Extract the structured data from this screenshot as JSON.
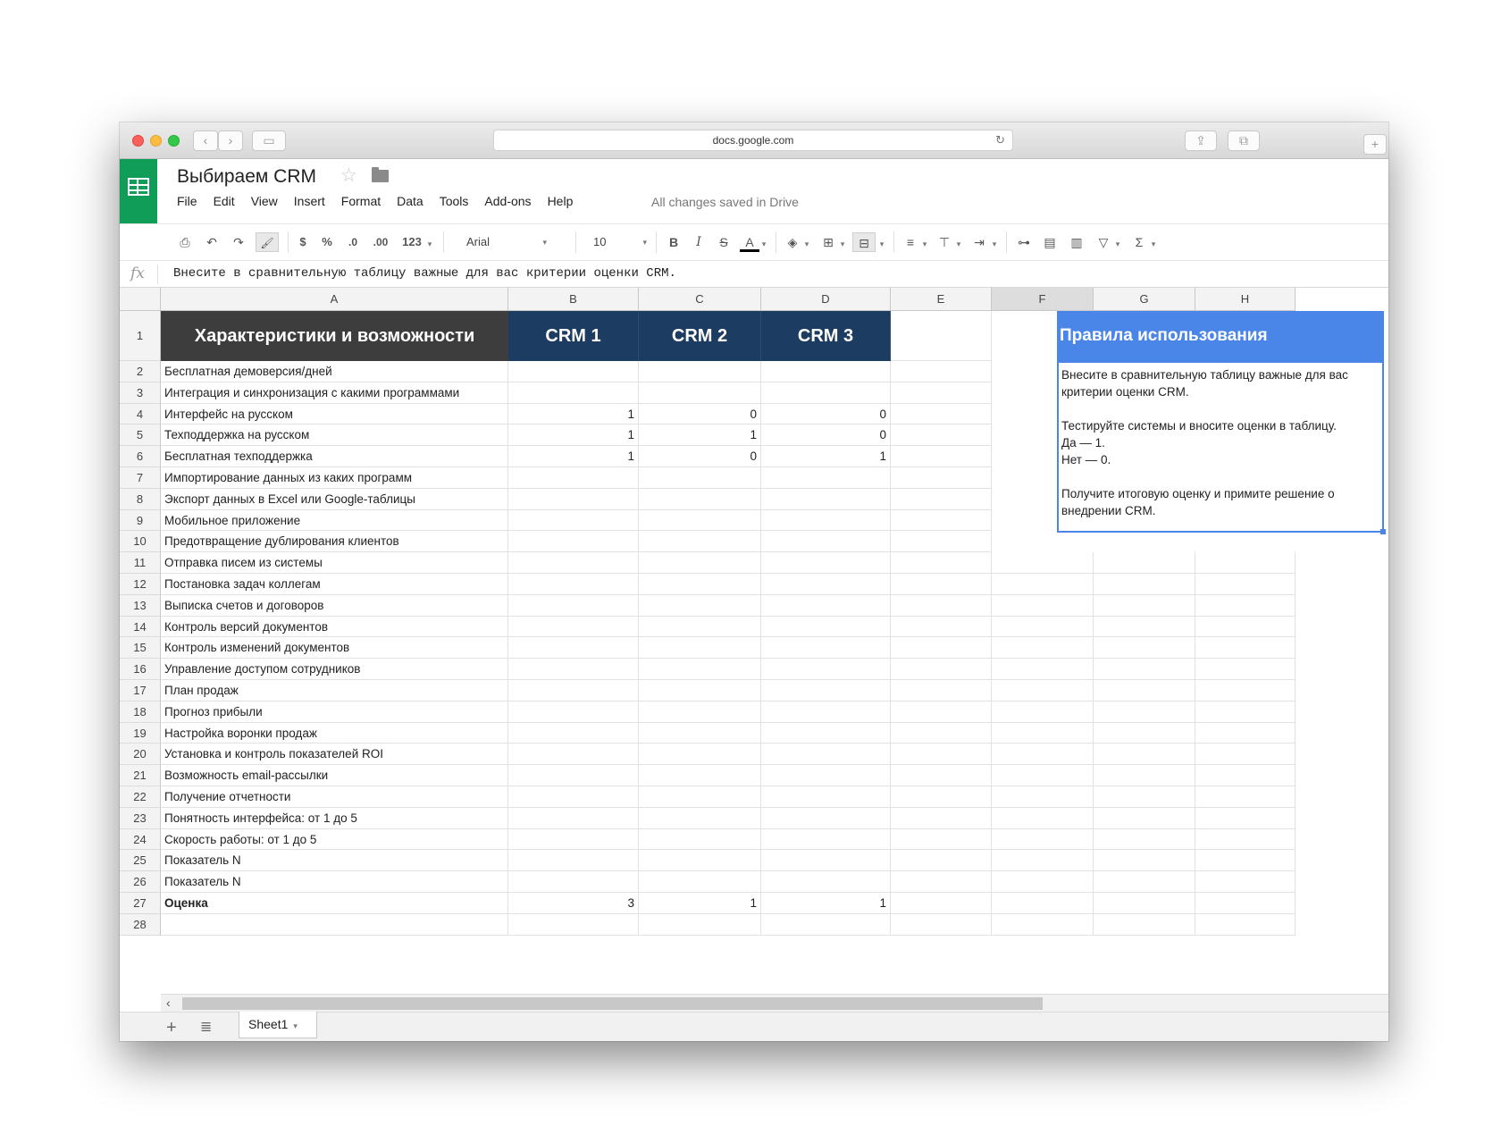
{
  "browser": {
    "url": "docs.google.com",
    "back_icon": "‹",
    "forward_icon": "›",
    "sidebar_icon": "▭",
    "reload_icon": "↻",
    "share_icon": "⇪",
    "tabs_icon": "⧉",
    "newtab_icon": "+"
  },
  "doc": {
    "title": "Выбираем CRM",
    "star_icon": "☆",
    "saved_status": "All changes saved in Drive",
    "menu": [
      "File",
      "Edit",
      "View",
      "Insert",
      "Format",
      "Data",
      "Tools",
      "Add-ons",
      "Help"
    ]
  },
  "toolbar": {
    "print_icon": "⎙",
    "undo_icon": "↶",
    "redo_icon": "↷",
    "paint_icon": "🖌",
    "currency": "$",
    "percent": "%",
    "dec_less": ".0",
    "dec_more": ".00",
    "more_formats": "123",
    "font": "Arial",
    "font_size": "10",
    "bold": "B",
    "italic": "I",
    "strike": "S",
    "text_color": "A",
    "fill_icon": "◈",
    "borders_icon": "⊞",
    "merge_icon": "⊟",
    "halign_icon": "≡",
    "valign_icon": "⊤",
    "wrap_icon": "⇥",
    "link_icon": "⊶",
    "comment_icon": "▤",
    "chart_icon": "▥",
    "filter_icon": "▽",
    "functions_icon": "Σ",
    "dropdown": "▾"
  },
  "formula_bar": {
    "fx": "fx",
    "content": "Внесите в сравнительную таблицу важные для вас критерии оценки CRM."
  },
  "columns": [
    "A",
    "B",
    "C",
    "D",
    "E",
    "F",
    "G",
    "H"
  ],
  "header_row": {
    "a": "Характеристики и возможности",
    "b": "CRM 1",
    "c": "CRM 2",
    "d": "CRM 3",
    "f": "Правила использования"
  },
  "rows": [
    {
      "n": "2",
      "a": "Бесплатная демоверсия/дней",
      "b": "",
      "c": "",
      "d": ""
    },
    {
      "n": "3",
      "a": "Интеграция и синхронизация с какими программами",
      "b": "",
      "c": "",
      "d": ""
    },
    {
      "n": "4",
      "a": "Интерфейс на русском",
      "b": "1",
      "c": "0",
      "d": "0"
    },
    {
      "n": "5",
      "a": "Техподдержка на русском",
      "b": "1",
      "c": "1",
      "d": "0"
    },
    {
      "n": "6",
      "a": "Бесплатная техподдержка",
      "b": "1",
      "c": "0",
      "d": "1"
    },
    {
      "n": "7",
      "a": "Импортирование данных из каких программ",
      "b": "",
      "c": "",
      "d": ""
    },
    {
      "n": "8",
      "a": "Экспорт данных в Excel или Google-таблицы",
      "b": "",
      "c": "",
      "d": ""
    },
    {
      "n": "9",
      "a": "Мобильное приложение",
      "b": "",
      "c": "",
      "d": ""
    },
    {
      "n": "10",
      "a": "Предотвращение дублирования клиентов",
      "b": "",
      "c": "",
      "d": ""
    },
    {
      "n": "11",
      "a": "Отправка писем из системы",
      "b": "",
      "c": "",
      "d": ""
    },
    {
      "n": "12",
      "a": "Постановка задач коллегам",
      "b": "",
      "c": "",
      "d": ""
    },
    {
      "n": "13",
      "a": "Выписка счетов и договоров",
      "b": "",
      "c": "",
      "d": ""
    },
    {
      "n": "14",
      "a": "Контроль версий документов",
      "b": "",
      "c": "",
      "d": ""
    },
    {
      "n": "15",
      "a": "Контроль изменений документов",
      "b": "",
      "c": "",
      "d": ""
    },
    {
      "n": "16",
      "a": "Управление доступом сотрудников",
      "b": "",
      "c": "",
      "d": ""
    },
    {
      "n": "17",
      "a": "План продаж",
      "b": "",
      "c": "",
      "d": ""
    },
    {
      "n": "18",
      "a": "Прогноз прибыли",
      "b": "",
      "c": "",
      "d": ""
    },
    {
      "n": "19",
      "a": "Настройка воронки продаж",
      "b": "",
      "c": "",
      "d": ""
    },
    {
      "n": "20",
      "a": "Установка и контроль показателей ROI",
      "b": "",
      "c": "",
      "d": ""
    },
    {
      "n": "21",
      "a": "Возможность email-рассылки",
      "b": "",
      "c": "",
      "d": ""
    },
    {
      "n": "22",
      "a": "Получение отчетности",
      "b": "",
      "c": "",
      "d": ""
    },
    {
      "n": "23",
      "a": "Понятность интерфейса: от 1 до 5",
      "b": "",
      "c": "",
      "d": ""
    },
    {
      "n": "24",
      "a": "Скорость работы: от 1 до 5",
      "b": "",
      "c": "",
      "d": ""
    },
    {
      "n": "25",
      "a": "Показатель N",
      "b": "",
      "c": "",
      "d": ""
    },
    {
      "n": "26",
      "a": "Показатель N",
      "b": "",
      "c": "",
      "d": ""
    },
    {
      "n": "27",
      "a": "Оценка",
      "b": "3",
      "c": "1",
      "d": "1",
      "bold": true
    },
    {
      "n": "28",
      "a": "",
      "b": "",
      "c": "",
      "d": ""
    }
  ],
  "rules": {
    "line1": "Внесите в сравнительную таблицу важные для вас критерии оценки CRM.",
    "line2": "Тестируйте системы и вносите оценки в таблицу.",
    "line3": "Да — 1.",
    "line4": "Нет — 0.",
    "line5": "Получите итоговую оценку и примите решение о внедрении CRM."
  },
  "sheets": {
    "add_icon": "+",
    "list_icon": "≣",
    "scroll_left_icon": "‹",
    "tab": "Sheet1",
    "tab_caret": "▾"
  },
  "colors": {
    "sheets_green": "#0f9d58",
    "header_dark": "#3d3d3d",
    "header_navy": "#1c3d61",
    "header_blue": "#4a86e8"
  }
}
